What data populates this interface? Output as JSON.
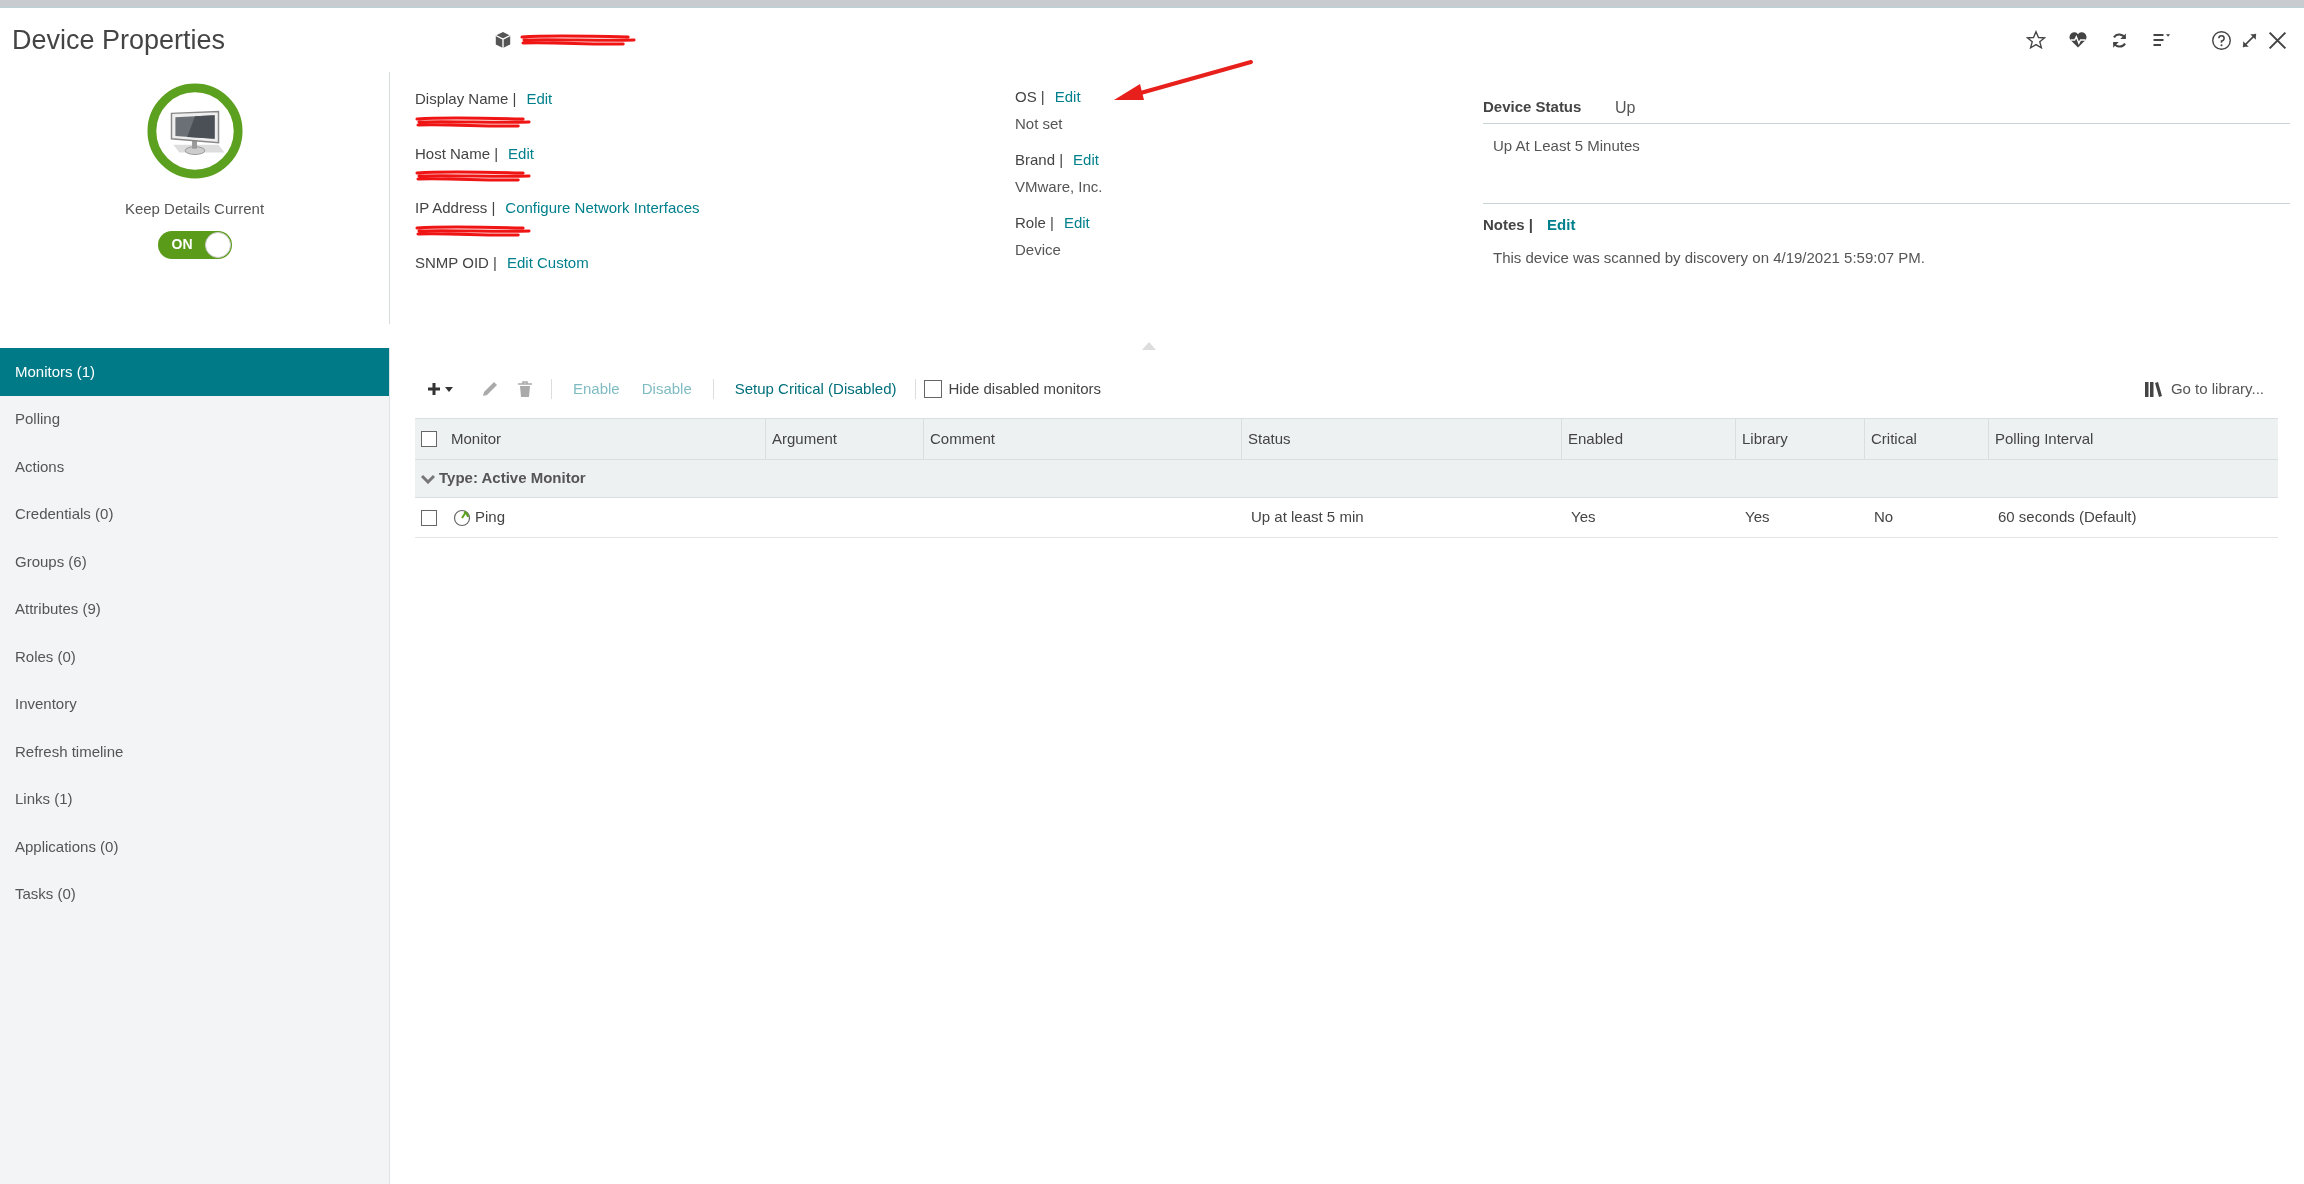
{
  "header": {
    "title": "Device Properties",
    "device_name_redacted": true
  },
  "keep_details": {
    "label": "Keep Details Current",
    "toggle_text": "ON",
    "on": true
  },
  "identity_fields": [
    {
      "label": "Display Name |",
      "link": "Edit",
      "value_redacted": true
    },
    {
      "label": "Host Name |",
      "link": "Edit",
      "value_redacted": true
    },
    {
      "label": "IP Address |",
      "link": "Configure Network Interfaces",
      "value_redacted": true
    },
    {
      "label": "SNMP OID |",
      "link": "Edit Custom",
      "value_redacted": false
    }
  ],
  "info_fields": [
    {
      "label": "OS |",
      "link": "Edit",
      "value": "Not set"
    },
    {
      "label": "Brand |",
      "link": "Edit",
      "value": "VMware, Inc."
    },
    {
      "label": "Role |",
      "link": "Edit",
      "value": "Device"
    }
  ],
  "device_status": {
    "label": "Device Status",
    "value": "Up",
    "detail": "Up At Least 5 Minutes"
  },
  "notes": {
    "label": "Notes |",
    "link": "Edit",
    "text": "This device was scanned by discovery on 4/19/2021 5:59:07 PM."
  },
  "sidebar": {
    "items": [
      {
        "label": "Monitors (1)",
        "selected": true
      },
      {
        "label": "Polling",
        "selected": false
      },
      {
        "label": "Actions",
        "selected": false
      },
      {
        "label": "Credentials (0)",
        "selected": false
      },
      {
        "label": "Groups (6)",
        "selected": false
      },
      {
        "label": "Attributes (9)",
        "selected": false
      },
      {
        "label": "Roles (0)",
        "selected": false
      },
      {
        "label": "Inventory",
        "selected": false
      },
      {
        "label": "Refresh timeline",
        "selected": false
      },
      {
        "label": "Links (1)",
        "selected": false
      },
      {
        "label": "Applications (0)",
        "selected": false
      },
      {
        "label": "Tasks (0)",
        "selected": false
      }
    ]
  },
  "toolbar": {
    "actions": [
      {
        "label": "Enable",
        "disabled": true
      },
      {
        "label": "Disable",
        "disabled": true
      },
      {
        "label": "Setup Critical (Disabled)",
        "disabled": false
      }
    ],
    "hide_disabled": {
      "label": "Hide disabled monitors",
      "checked": false
    },
    "library_link": "Go to library..."
  },
  "table": {
    "select_all_checked": false,
    "columns": [
      "Monitor",
      "Argument",
      "Comment",
      "Status",
      "Enabled",
      "Library",
      "Critical",
      "Polling Interval"
    ],
    "group": {
      "label": "Type: Active Monitor",
      "expanded": true
    },
    "rows": [
      {
        "checked": false,
        "monitor": "Ping",
        "status": "Up at least 5 min",
        "enabled": "Yes",
        "library": "Yes",
        "critical": "No",
        "polling_interval": "60 seconds (Default)"
      }
    ]
  }
}
